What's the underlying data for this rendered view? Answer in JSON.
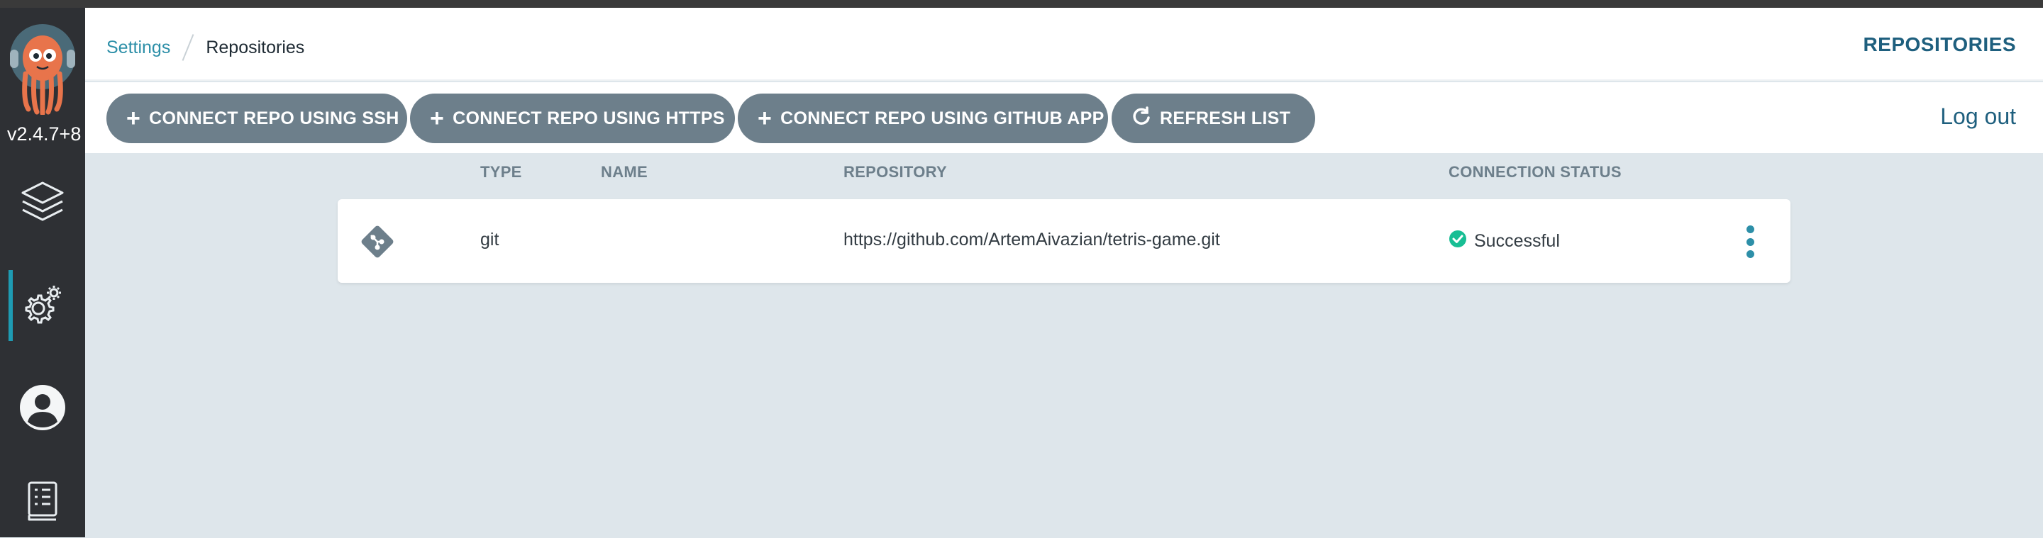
{
  "sidebar": {
    "version": "v2.4.7+8",
    "items": [
      {
        "name": "applications",
        "icon": "layers-icon"
      },
      {
        "name": "settings",
        "icon": "gear-icon",
        "active": true
      },
      {
        "name": "user-info",
        "icon": "user-icon"
      },
      {
        "name": "documentation",
        "icon": "book-icon"
      }
    ]
  },
  "header": {
    "breadcrumb": {
      "parent": "Settings",
      "current": "Repositories"
    },
    "title": "REPOSITORIES"
  },
  "toolbar": {
    "connect_ssh": "CONNECT REPO USING SSH",
    "connect_https": "CONNECT REPO USING HTTPS",
    "connect_github_app": "CONNECT REPO USING GITHUB APP",
    "refresh": "REFRESH LIST",
    "logout": "Log out"
  },
  "table": {
    "columns": {
      "type": "TYPE",
      "name": "NAME",
      "repository": "REPOSITORY",
      "status": "CONNECTION STATUS"
    },
    "rows": [
      {
        "icon": "git-icon",
        "type": "git",
        "name": "",
        "repository": "https://github.com/ArtemAivazian/tetris-game.git",
        "status": "Successful"
      }
    ]
  },
  "colors": {
    "sidebar_bg": "#2e3034",
    "accent": "#2d8fa8",
    "button_bg": "#6d7f8b",
    "success": "#18be94",
    "content_bg": "#dee6eb"
  }
}
